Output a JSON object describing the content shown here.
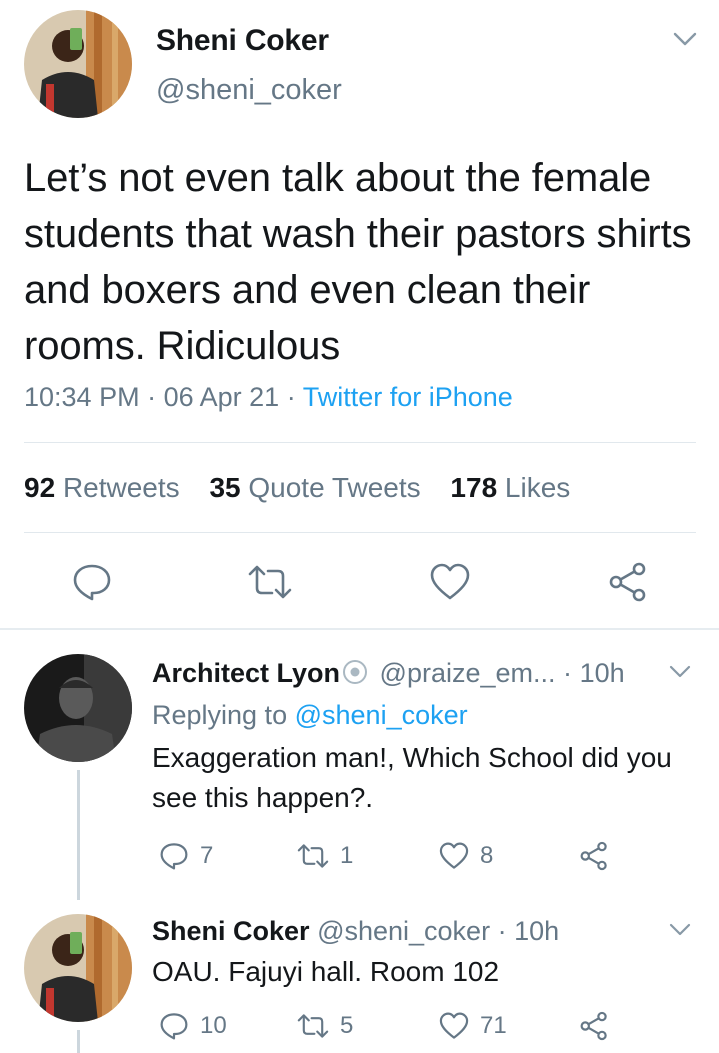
{
  "main_tweet": {
    "author_name": "Sheni Coker",
    "author_handle": "@sheni_coker",
    "text": "Let’s not even talk about the female students that wash their pastors shirts and boxers and even clean their rooms. Ridiculous",
    "time": "10:34 PM",
    "date": "06 Apr 21",
    "separator": "·",
    "source": "Twitter for iPhone",
    "stats": {
      "retweets_count": "92",
      "retweets_label": "Retweets",
      "quotes_count": "35",
      "quotes_label": "Quote Tweets",
      "likes_count": "178",
      "likes_label": "Likes"
    }
  },
  "replies": [
    {
      "author_name": "Architect Lyon",
      "author_handle": "@praize_em...",
      "time": "10h",
      "replying_prefix": "Replying to",
      "replying_to": "@sheni_coker",
      "text": "Exaggeration man!, Which School did you see this happen?.",
      "reply_count": "7",
      "retweet_count": "1",
      "like_count": "8"
    },
    {
      "author_name": "Sheni Coker",
      "author_handle": "@sheni_coker",
      "time": "10h",
      "text": "OAU. Fajuyi hall. Room 102",
      "reply_count": "10",
      "retweet_count": "5",
      "like_count": "71"
    }
  ],
  "colors": {
    "accent": "#1da1f2",
    "secondary_text": "#657786",
    "primary_text": "#14171a",
    "divider": "#e1e8ed"
  }
}
